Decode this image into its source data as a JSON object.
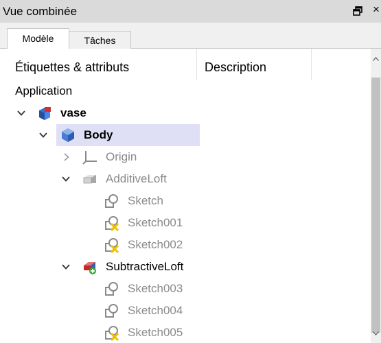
{
  "panel": {
    "title": "Vue combinée"
  },
  "tabs": [
    {
      "label": "Modèle"
    },
    {
      "label": "Tâches"
    }
  ],
  "columns": {
    "labels_attributes": "Étiquettes & attributs",
    "description": "Description"
  },
  "tree": {
    "root": "Application",
    "document": "vase",
    "body": "Body",
    "origin": "Origin",
    "additive_loft": "AdditiveLoft",
    "sketch": "Sketch",
    "sketch001": "Sketch001",
    "sketch002": "Sketch002",
    "subtractive_loft": "SubtractiveLoft",
    "sketch003": "Sketch003",
    "sketch004": "Sketch004",
    "sketch005": "Sketch005"
  },
  "colors": {
    "selection": "#dfe0f5",
    "inactive_text": "#8a8a8a",
    "warning": "#f0c000",
    "add": "#2faa2f"
  }
}
